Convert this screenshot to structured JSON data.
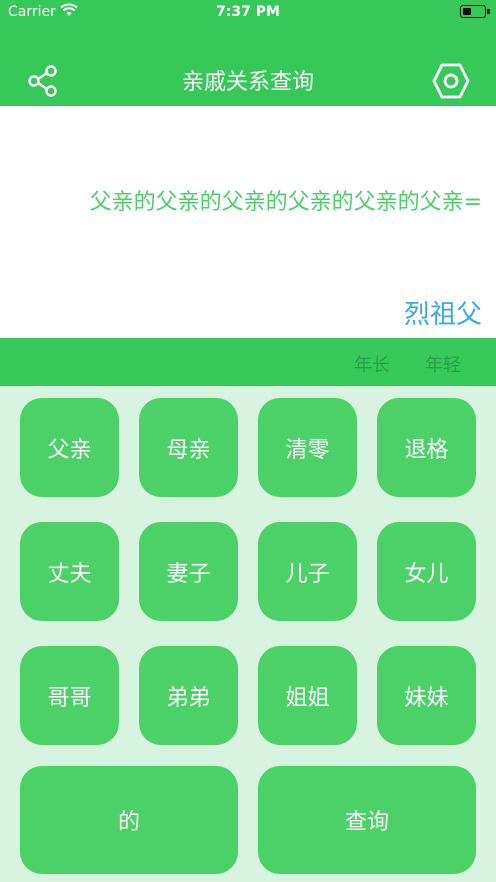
{
  "status": {
    "carrier": "Carrier",
    "time": "7:37 PM"
  },
  "nav": {
    "title": "亲戚关系查询",
    "share_icon": "share-icon",
    "settings_icon": "settings-icon"
  },
  "display": {
    "expression": "父亲的父亲的父亲的父亲的父亲的父亲=",
    "result": "烈祖父"
  },
  "modes": {
    "older": "年长",
    "younger": "年轻"
  },
  "keys": {
    "father": "父亲",
    "mother": "母亲",
    "clear": "清零",
    "backspace": "退格",
    "husband": "丈夫",
    "wife": "妻子",
    "son": "儿子",
    "daughter": "女儿",
    "elder_brother": "哥哥",
    "younger_brother": "弟弟",
    "elder_sister": "姐姐",
    "younger_sister": "妹妹",
    "of": "的",
    "query": "查询"
  },
  "colors": {
    "primary": "#37c85a",
    "key": "#4cd068",
    "background": "#d8f4e0",
    "result": "#3aa8ea"
  }
}
